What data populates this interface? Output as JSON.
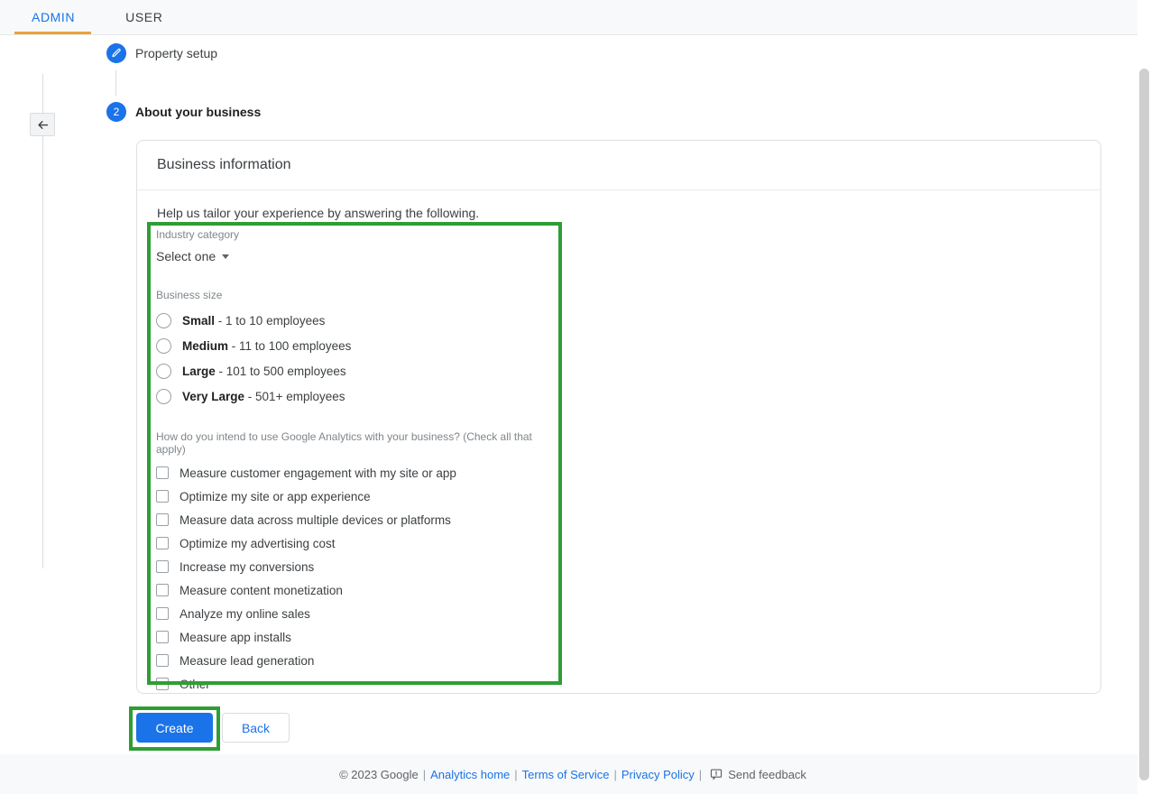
{
  "tabs": [
    {
      "label": "ADMIN",
      "active": true
    },
    {
      "label": "USER",
      "active": false
    }
  ],
  "nav": {
    "back_button_icon": "arrow-left-icon"
  },
  "stepper": {
    "steps": [
      {
        "badge": "check-edit-icon",
        "label": "Property setup",
        "state": "completed"
      },
      {
        "badge": "2",
        "label": "About your business",
        "state": "active"
      }
    ]
  },
  "card": {
    "title": "Business information",
    "helper_text": "Help us tailor your experience by answering the following."
  },
  "industry": {
    "label": "Industry category",
    "selected": "Select one",
    "caret_icon": "caret-down-icon"
  },
  "business_size": {
    "label": "Business size",
    "options": [
      {
        "name": "Small",
        "detail": " - 1 to 10 employees",
        "checked": false
      },
      {
        "name": "Medium",
        "detail": " - 11 to 100 employees",
        "checked": false
      },
      {
        "name": "Large",
        "detail": " - 101 to 500 employees",
        "checked": false
      },
      {
        "name": "Very Large",
        "detail": " - 501+ employees",
        "checked": false
      }
    ]
  },
  "intent": {
    "label": "How do you intend to use Google Analytics with your business? (Check all that apply)",
    "options": [
      {
        "label": "Measure customer engagement with my site or app",
        "checked": false
      },
      {
        "label": "Optimize my site or app experience",
        "checked": false
      },
      {
        "label": "Measure data across multiple devices or platforms",
        "checked": false
      },
      {
        "label": "Optimize my advertising cost",
        "checked": false
      },
      {
        "label": "Increase my conversions",
        "checked": false
      },
      {
        "label": "Measure content monetization",
        "checked": false
      },
      {
        "label": "Analyze my online sales",
        "checked": false
      },
      {
        "label": "Measure app installs",
        "checked": false
      },
      {
        "label": "Measure lead generation",
        "checked": false
      },
      {
        "label": "Other",
        "checked": false
      }
    ]
  },
  "actions": {
    "create_label": "Create",
    "back_label": "Back"
  },
  "footer": {
    "copyright": "© 2023 Google",
    "sep": "|",
    "links": [
      "Analytics home",
      "Terms of Service",
      "Privacy Policy"
    ],
    "feedback_label": "Send feedback",
    "feedback_icon": "feedback-icon"
  },
  "highlights": {
    "color": "#2e9e34",
    "boxes": [
      "business-information-form",
      "create-button"
    ]
  },
  "colors": {
    "accent_blue": "#1a73e8",
    "tab_underline": "#e8a33d",
    "highlight_green": "#2e9e34",
    "text_primary": "#202124",
    "text_secondary": "#5f6368",
    "label_grey": "#80868b"
  }
}
